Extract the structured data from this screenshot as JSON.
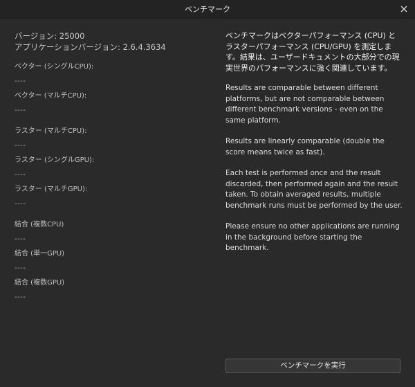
{
  "window": {
    "title": "ベンチマーク",
    "close_icon": "close-icon"
  },
  "info": {
    "version": "バージョン: 25000",
    "app_version": "アプリケーションバージョン: 2.6.4.3634"
  },
  "benchmarks": [
    {
      "label": "ベクター (シングルCPU):",
      "value": "----"
    },
    {
      "label": "ベクター (マルチCPU):",
      "value": "----"
    },
    {
      "label": "ラスター (マルチCPU):",
      "value": "----"
    },
    {
      "label": "ラスター (シングルGPU):",
      "value": "----"
    },
    {
      "label": "ラスター (マルチGPU):",
      "value": "----"
    },
    {
      "label": "結合 (複数CPU)",
      "value": "----"
    },
    {
      "label": "結合 (単一GPU)",
      "value": "----"
    },
    {
      "label": "結合 (複数GPU)",
      "value": "----"
    }
  ],
  "description": {
    "intro": "ベンチマークはベクターパフォーマンス (CPU) とラスターパフォーマンス (CPU/GPU) を測定します。結果は、ユーザードキュメントの大部分での現実世界のパフォーマンスに強く関連しています。",
    "p1": "Results are comparable between different platforms, but are not comparable between different benchmark versions - even on the same platform.",
    "p2": "Results are linearly comparable (double the score means twice as fast).",
    "p3": "Each test is performed once and the result discarded, then performed again and the result taken. To obtain averaged results, multiple benchmark runs must be performed by the user.",
    "p4": "Please ensure no other applications are running in the background before starting the benchmark."
  },
  "actions": {
    "run_label": "ベンチマークを実行"
  }
}
